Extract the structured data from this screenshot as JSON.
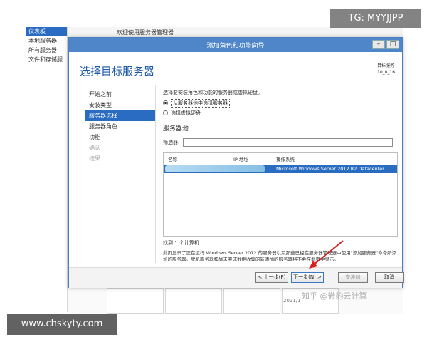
{
  "server_manager": {
    "sidebar": [
      {
        "label": "仪表板",
        "active": true
      },
      {
        "label": "本地服务器",
        "active": false
      },
      {
        "label": "所有服务器",
        "active": false
      },
      {
        "label": "文件和存储服",
        "active": false
      }
    ],
    "header_text": "欢迎使用服务器管理器",
    "bottom_date": "2021/1"
  },
  "wizard": {
    "title": "添加角色和功能向导",
    "heading": "选择目标服务器",
    "destination": {
      "label": "目标服务",
      "value": "10_0_16"
    },
    "nav": [
      {
        "label": "开始之前",
        "state": "normal"
      },
      {
        "label": "安装类型",
        "state": "normal"
      },
      {
        "label": "服务器选择",
        "state": "active"
      },
      {
        "label": "服务器角色",
        "state": "normal"
      },
      {
        "label": "功能",
        "state": "normal"
      },
      {
        "label": "确认",
        "state": "disabled"
      },
      {
        "label": "结果",
        "state": "disabled"
      }
    ],
    "intro": "选择要安装角色和功能的服务器或虚拟硬盘。",
    "options": [
      {
        "label": "从服务器池中选择服务器",
        "selected": true
      },
      {
        "label": "选择虚拟硬盘",
        "selected": false
      }
    ],
    "pool_title": "服务器池",
    "filter_label": "筛选器:",
    "filter_value": "",
    "columns": [
      "名称",
      "IP 地址",
      "操作系统"
    ],
    "rows": [
      {
        "name": "",
        "ip": "",
        "os": "Microsoft Windows Server 2012 R2 Datacenter"
      }
    ],
    "found": "找到 1 个计算机",
    "note": "此页显示了正在运行 Windows Server 2012 的服务器以及那些已经在服务器管理器中使用\"添加服务器\"命令所添加的服务器。脱机服务器和尚未完成数据收集的新添加的服务器将不会在此页中显示。",
    "buttons": {
      "prev": "< 上一步(P)",
      "next": "下一步(N) >",
      "install": "安装(I)",
      "cancel": "取消"
    },
    "window_buttons": {
      "minimize": "–",
      "maximize": "□"
    }
  },
  "watermarks": {
    "tg": "TG: MYYJJPP",
    "site": "www.chskyty.com",
    "zh": "知乎 @微豹云计算"
  },
  "colors": {
    "titlebar": "#4e86c9",
    "accent": "#2a6cc1",
    "heading": "#1e5aa8"
  }
}
